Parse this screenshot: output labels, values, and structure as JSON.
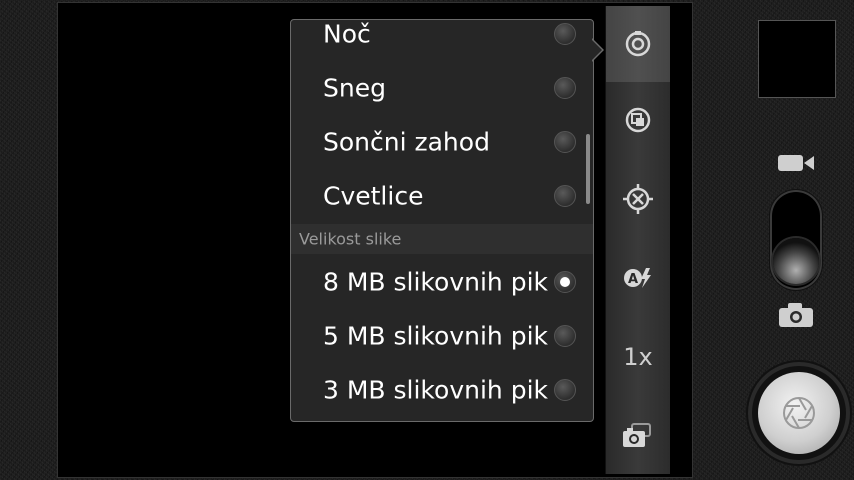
{
  "popup": {
    "scene_items": [
      {
        "label": "Noč",
        "selected": false
      },
      {
        "label": "Sneg",
        "selected": false
      },
      {
        "label": "Sončni zahod",
        "selected": false
      },
      {
        "label": "Cvetlice",
        "selected": false
      }
    ],
    "size_header": "Velikost slike",
    "size_items": [
      {
        "label": "8 MB slikovnih pik",
        "selected": true
      },
      {
        "label": "5 MB slikovnih pik",
        "selected": false
      },
      {
        "label": "3 MB slikovnih pik",
        "selected": false
      }
    ]
  },
  "settings_bar": {
    "buttons": [
      {
        "icon": "camera-settings-icon",
        "selected": true
      },
      {
        "icon": "scene-mode-icon",
        "selected": false
      },
      {
        "icon": "focus-mode-icon",
        "selected": false
      },
      {
        "icon": "flash-auto-icon",
        "selected": false
      },
      {
        "icon": "zoom-icon",
        "label": "1x",
        "selected": false
      },
      {
        "icon": "switch-camera-icon",
        "selected": false
      }
    ]
  },
  "mode": "camera",
  "colors": {
    "popup_bg": "#262626",
    "popup_border": "#6a6a6a",
    "text": "#ffffff",
    "header_text": "#9a9a9a"
  }
}
